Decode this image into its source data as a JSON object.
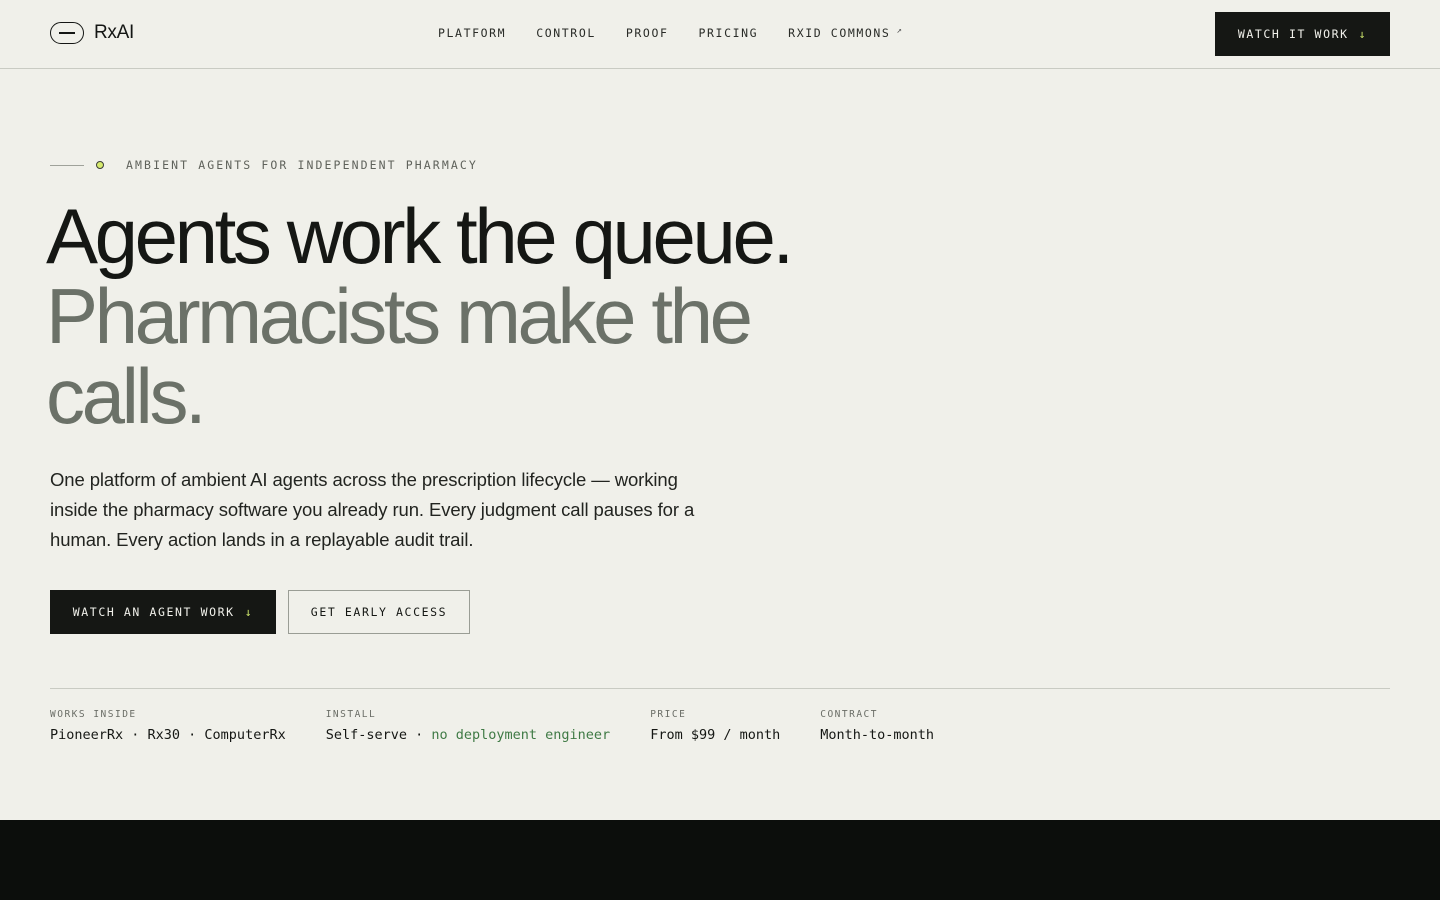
{
  "header": {
    "logo_text": "RxAI",
    "nav": [
      {
        "label": "PLATFORM"
      },
      {
        "label": "CONTROL"
      },
      {
        "label": "PROOF"
      },
      {
        "label": "PRICING"
      },
      {
        "label": "RXID COMMONS",
        "external_mark": "↗"
      }
    ],
    "cta_label": "WATCH IT WORK",
    "cta_arrow": "↓"
  },
  "hero": {
    "eyebrow": "AMBIENT AGENTS FOR INDEPENDENT PHARMACY",
    "headline_line1": "Agents work the queue.",
    "headline_line2": "Pharmacists make the calls.",
    "lede": "One platform of ambient AI agents across the prescription lifecycle — working inside the pharmacy software you already run. Every judgment call pauses for a human. Every action lands in a replayable audit trail.",
    "primary_cta": "WATCH AN AGENT WORK",
    "primary_cta_arrow": "↓",
    "secondary_cta": "GET EARLY ACCESS"
  },
  "facts": [
    {
      "label": "WORKS INSIDE",
      "value": "PioneerRx · Rx30 · ComputerRx"
    },
    {
      "label": "INSTALL",
      "value": "Self-serve · ",
      "accent": "no deployment engineer"
    },
    {
      "label": "PRICE",
      "value": "From $99 / month"
    },
    {
      "label": "CONTRACT",
      "value": "Month-to-month"
    }
  ],
  "colors": {
    "background": "#f0f0ea",
    "ink": "#151714",
    "muted_headline": "#6b7168",
    "accent_lime": "#c8e06a",
    "accent_green": "#3f7a45",
    "dark_band": "#0c0e0c"
  }
}
